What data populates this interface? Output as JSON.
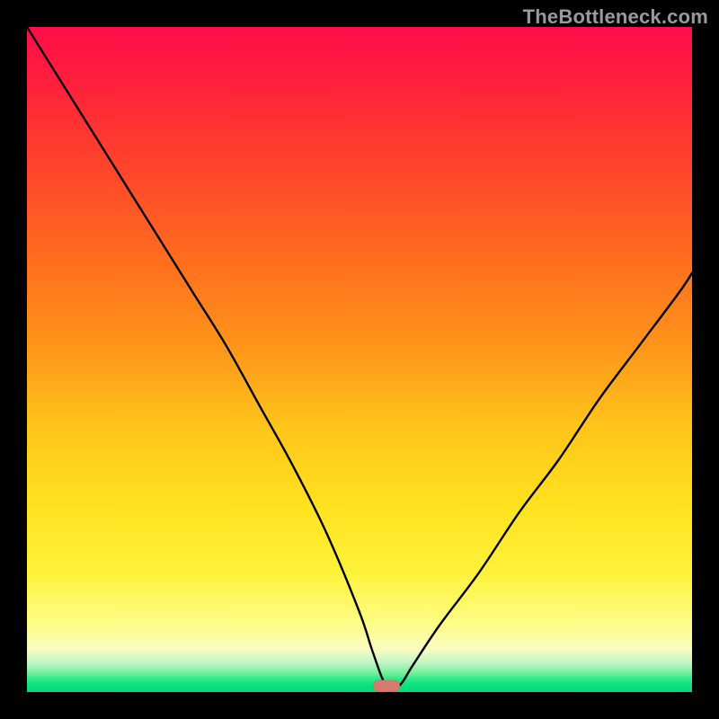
{
  "watermark": "TheBottleneck.com",
  "chart_data": {
    "type": "line",
    "title": "",
    "xlabel": "",
    "ylabel": "",
    "xlim": [
      0,
      100
    ],
    "ylim": [
      0,
      100
    ],
    "grid": false,
    "legend": false,
    "annotations": [
      {
        "kind": "min-marker",
        "x": 54,
        "y": 1
      }
    ],
    "series": [
      {
        "name": "bottleneck-curve",
        "x": [
          0,
          5,
          10,
          15,
          20,
          25,
          30,
          35,
          40,
          45,
          50,
          52,
          54,
          56,
          58,
          62,
          68,
          74,
          80,
          86,
          92,
          98,
          100
        ],
        "y": [
          100,
          92,
          84,
          76,
          68,
          60,
          52,
          43,
          34,
          24,
          12,
          6,
          1,
          1,
          4,
          10,
          18,
          27,
          35,
          44,
          52,
          60,
          63
        ]
      }
    ],
    "colors": {
      "gradient_stops": [
        {
          "pos": 0.0,
          "hex": "#ff0d4a"
        },
        {
          "pos": 0.18,
          "hex": "#ff3c2f"
        },
        {
          "pos": 0.48,
          "hex": "#ff951a"
        },
        {
          "pos": 0.72,
          "hex": "#ffe21f"
        },
        {
          "pos": 0.9,
          "hex": "#fdfd8a"
        },
        {
          "pos": 0.97,
          "hex": "#7df0a0"
        },
        {
          "pos": 1.0,
          "hex": "#06d877"
        }
      ],
      "curve": "#000000",
      "marker": "#d87b6f"
    }
  }
}
